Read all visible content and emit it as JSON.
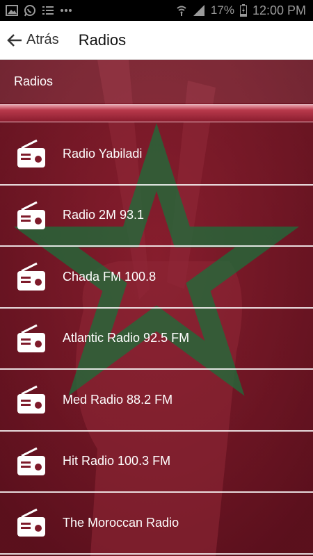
{
  "status_bar": {
    "battery": "17%",
    "time": "12:00 PM",
    "icons": [
      "image-icon",
      "whatsapp-icon",
      "list-icon",
      "more-icon",
      "wifi-icon",
      "signal-icon",
      "battery-icon"
    ]
  },
  "app_bar": {
    "back_label": "Atrás",
    "title": "Radios"
  },
  "section": {
    "header": "Radios"
  },
  "radios": [
    {
      "label": "Radio Yabiladi"
    },
    {
      "label": "Radio 2M 93.1"
    },
    {
      "label": "Chada FM 100.8"
    },
    {
      "label": "Atlantic Radio 92.5 FM"
    },
    {
      "label": "Med Radio 88.2 FM"
    },
    {
      "label": "Hit Radio 100.3 FM"
    },
    {
      "label": "The Moroccan Radio"
    }
  ],
  "colors": {
    "background": "#7e1a2a",
    "star": "#1f6b3a",
    "text": "#ffffff"
  }
}
